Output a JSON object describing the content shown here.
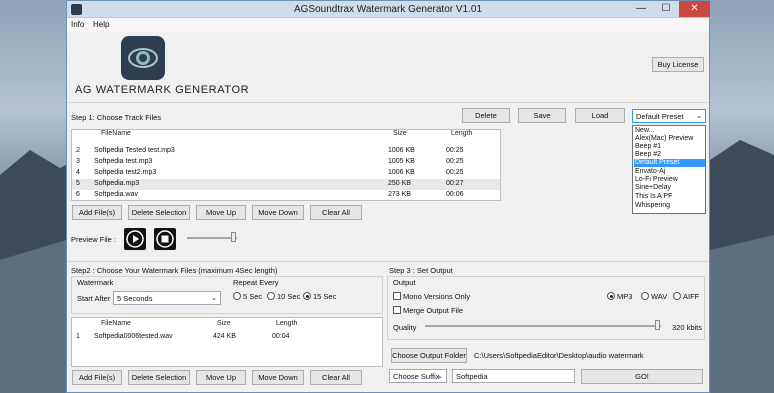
{
  "window": {
    "title": "AGSoundtrax Watermark Generator V1.01",
    "min": "—",
    "max": "☐",
    "close": "✕"
  },
  "menu": {
    "items": [
      "Info",
      "Help"
    ]
  },
  "logo": {
    "text": "AG WATERMARK GENERATOR",
    "icon": "eye-logo-icon"
  },
  "buy_license": "Buy License",
  "step1": {
    "label": "Step 1: Choose Track Files",
    "delete": "Delete",
    "save": "Save",
    "load": "Load",
    "preset_value": "Default Preset",
    "columns": [
      "FileName",
      "Size",
      "Length"
    ],
    "rows": [
      {
        "num": "2",
        "name": "Softpedia Tested test.mp3",
        "size": "1006 KB",
        "length": "00:25"
      },
      {
        "num": "3",
        "name": "Softpedia test.mp3",
        "size": "1005 KB",
        "length": "00:25"
      },
      {
        "num": "4",
        "name": "Softpedia test2.mp3",
        "size": "1006 KB",
        "length": "00:25"
      },
      {
        "num": "5",
        "name": "Softpedia.mp3",
        "size": "250 KB",
        "length": "00:27"
      },
      {
        "num": "6",
        "name": "Softpedia.wav",
        "size": "273 KB",
        "length": "00:06"
      }
    ],
    "add_files": "Add File(s)",
    "delete_selection": "Delete Selection",
    "move_up": "Move Up",
    "move_down": "Move Down",
    "clear_all": "Clear All",
    "preview_label": "Preview File :"
  },
  "presets": [
    "New...",
    "Alex(Mac) Preview",
    "Beep #1",
    "Beep #2",
    "Default Preset",
    "Envato-Aj",
    "Lo-Fi Preview",
    "Sine+Delay",
    "This Is A PF",
    "Whispering"
  ],
  "step2": {
    "label": "Step2 : Choose Your Watermark Files (maximum 4Sec length)",
    "watermark": "Watermark",
    "start_after": "Start After",
    "start_after_value": "5 Seconds",
    "repeat_every": "Repeat Every",
    "repeat_options": [
      "5 Sec",
      "10 Sec",
      "15 Sec"
    ],
    "columns": [
      "FileName",
      "Size",
      "Length"
    ],
    "rows": [
      {
        "num": "1",
        "name": "Softpedia0006tested.wav",
        "size": "424 KB",
        "length": "00:04"
      }
    ],
    "add_files": "Add File(s)",
    "delete_selection": "Delete Selection",
    "move_up": "Move Up",
    "move_down": "Move Down",
    "clear_all": "Clear All"
  },
  "step3": {
    "label": "Step 3 : Set Output",
    "output": "Output",
    "mono": "Mono Versions Only",
    "merge": "Merge Output File",
    "formats": [
      "MP3",
      "WAV",
      "AIFF"
    ],
    "quality_label": "Quality",
    "quality_value": "320 kbits",
    "quality_level": 1.0,
    "choose_folder": "Choose Output Folder",
    "folder_path": "C:\\Users\\SoftpediaEditor\\Desktop\\audio watermark",
    "choose_suffix": "Choose Suffix",
    "suffix_value": "Softpedia",
    "go": "GO!"
  },
  "colors": {
    "accent": "#3399ff",
    "close": "#c7493f",
    "logo_bg": "#2e3e4e"
  }
}
